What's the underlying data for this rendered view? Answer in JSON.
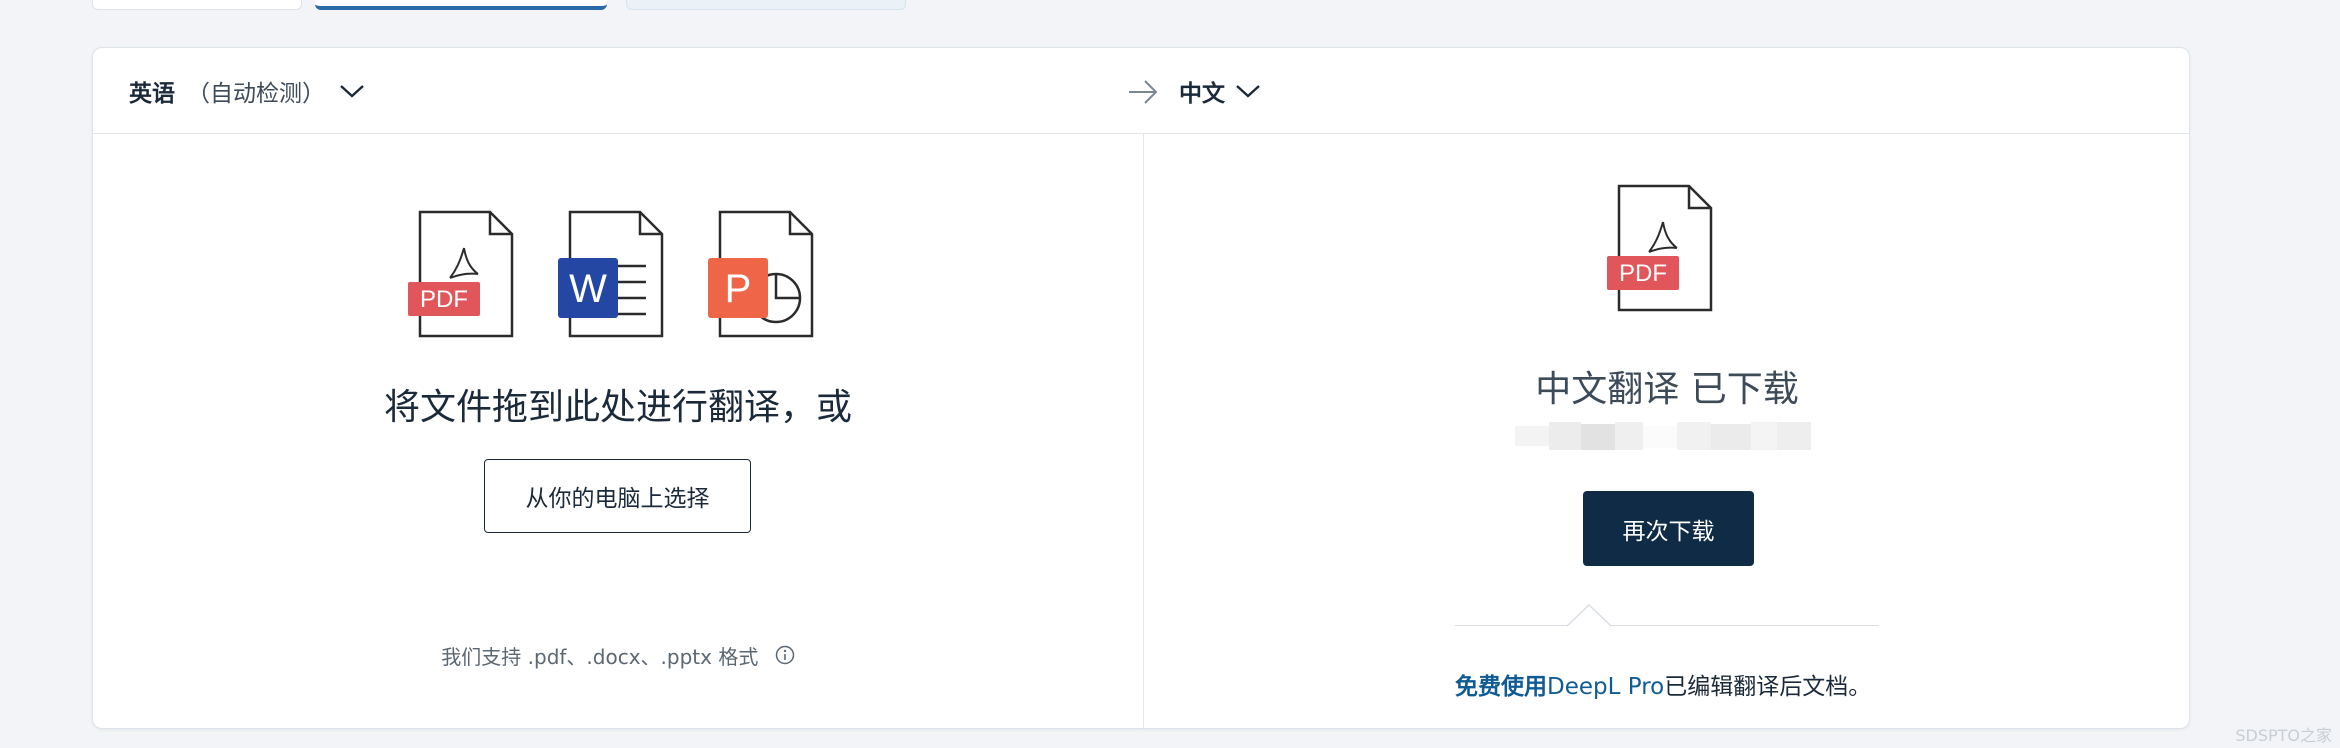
{
  "header": {
    "source_language": "英语",
    "source_detect": "（自动检测）",
    "target_language": "中文"
  },
  "upload": {
    "file_types": [
      "PDF",
      "W",
      "P"
    ],
    "drop_text": "将文件拖到此处进行翻译，或",
    "pick_button": "从你的电脑上选择",
    "support_text": "我们支持 .pdf、.docx、.pptx 格式"
  },
  "result": {
    "file_label": "PDF",
    "status_text": "中文翻译 已下载",
    "download_again_button": "再次下载",
    "pro_link_bold": "免费使用",
    "pro_link_rest": "DeepL Pro",
    "pro_suffix": "已编辑翻译后文档。"
  },
  "watermark": "SDSPTO之家",
  "colors": {
    "pdf": "#e0565a",
    "word": "#2347a3",
    "powerpoint": "#ee6647",
    "primary_button": "#0f2b46",
    "link": "#0f5c95"
  }
}
